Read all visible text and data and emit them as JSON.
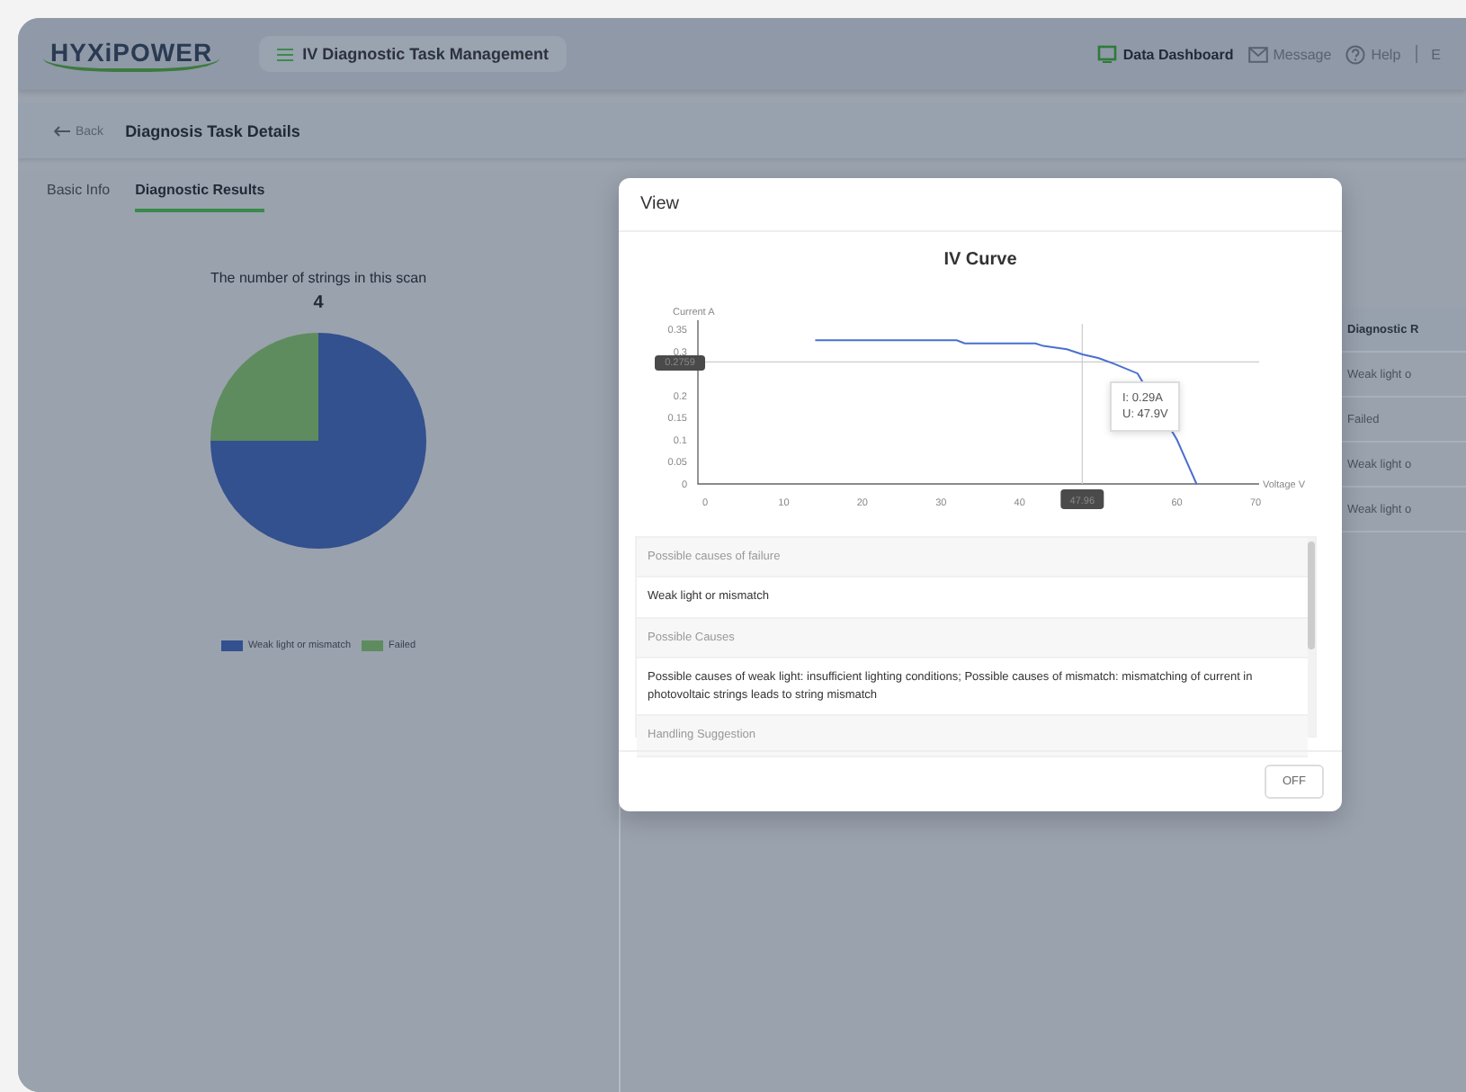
{
  "header": {
    "logo": "HYXiPOWER",
    "module": "IV Diagnostic Task Management",
    "links": [
      {
        "label": "Data Dashboard",
        "active": true
      },
      {
        "label": "Message",
        "active": false
      },
      {
        "label": "Help",
        "active": false
      }
    ],
    "cut_link": "E"
  },
  "breadcrumb": {
    "back": "Back",
    "title": "Diagnosis Task Details"
  },
  "tabs": [
    {
      "label": "Basic Info",
      "selected": false
    },
    {
      "label": "Diagnostic Results",
      "selected": true
    }
  ],
  "summary": {
    "title": "The number of strings in this scan",
    "count": "4",
    "chart_data": {
      "type": "pie",
      "categories": [
        "Weak light or mismatch",
        "Failed"
      ],
      "values": [
        75,
        25
      ],
      "colors": [
        "#33508f",
        "#5e8c5e"
      ]
    }
  },
  "table": {
    "column": "Diagnostic R",
    "rows": [
      "Weak light o",
      "Failed",
      "Weak light o",
      "Weak light o"
    ]
  },
  "modal": {
    "title": "View",
    "chart_data": {
      "type": "line",
      "title": "IV Curve",
      "xlabel": "Voltage V",
      "ylabel": "Current A",
      "xlim": [
        0,
        70
      ],
      "ylim": [
        0,
        0.35
      ],
      "xticks": [
        0,
        10,
        20,
        30,
        40,
        60,
        70
      ],
      "yticks": [
        0,
        0.05,
        0.1,
        0.15,
        0.2,
        0.3,
        0.35
      ],
      "series": [
        {
          "color": "#4a6fd0",
          "x": [
            14,
            32,
            33,
            42,
            43,
            46,
            48,
            50,
            52,
            55,
            60,
            62.5
          ],
          "values": [
            0.325,
            0.325,
            0.318,
            0.318,
            0.312,
            0.305,
            0.293,
            0.285,
            0.272,
            0.25,
            0.1,
            0
          ]
        }
      ],
      "ref_lines": [
        {
          "axis": "x",
          "value": 47.96,
          "label": "47.96"
        },
        {
          "axis": "y",
          "value": 0.2759,
          "label": "0.2759"
        }
      ]
    },
    "tooltip": [
      "I: 0.29A",
      "U: 47.9V"
    ],
    "details": [
      {
        "kind": "label",
        "text": "Possible causes of failure"
      },
      {
        "kind": "value",
        "text": "Weak light or mismatch"
      },
      {
        "kind": "label",
        "text": "Possible Causes"
      },
      {
        "kind": "value",
        "text": "Possible causes of weak light: insufficient lighting conditions; Possible causes of mismatch: mismatching of current in photovoltaic strings leads to string mismatch"
      },
      {
        "kind": "label",
        "text": "Handling Suggestion"
      }
    ],
    "button": "OFF"
  }
}
